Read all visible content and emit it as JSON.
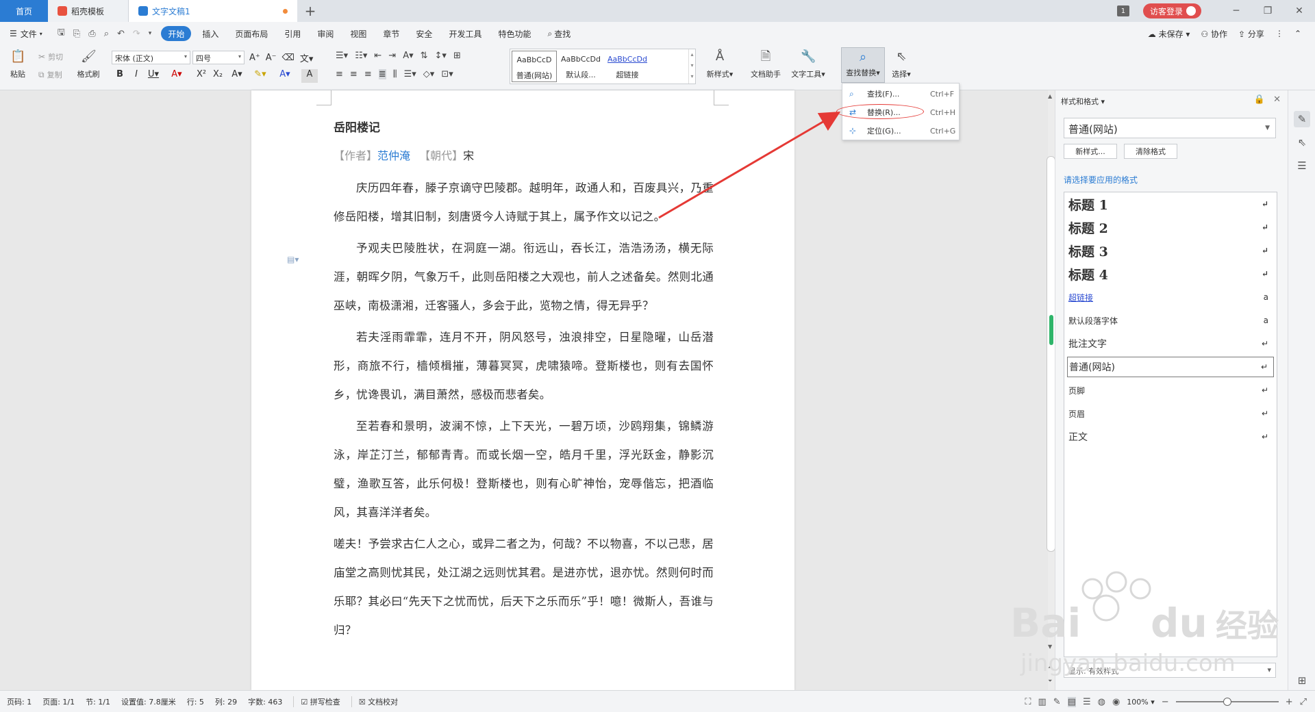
{
  "tabs": {
    "home": "首页",
    "daoke": "稻壳模板",
    "doc": "文字文稿1",
    "new_tab": "+",
    "badge": "1",
    "login": "访客登录"
  },
  "menu": {
    "file": "文件",
    "items": [
      "开始",
      "插入",
      "页面布局",
      "引用",
      "审阅",
      "视图",
      "章节",
      "安全",
      "开发工具",
      "特色功能"
    ],
    "search": "查找",
    "unsaved": "未保存",
    "collab": "协作",
    "share": "分享"
  },
  "ribbon": {
    "paste": "粘贴",
    "cut": "剪切",
    "copy": "复制",
    "format_painter": "格式刷",
    "font_name": "宋体 (正文)",
    "font_size": "四号",
    "styles": [
      {
        "preview": "AaBbCcD",
        "label": "普通(网站)"
      },
      {
        "preview": "AaBbCcDd",
        "label": "默认段..."
      },
      {
        "preview": "AaBbCcDd",
        "label": "超链接"
      }
    ],
    "new_style": "新样式",
    "doc_helper": "文档助手",
    "text_tools": "文字工具",
    "find_replace": "查找替换",
    "select": "选择"
  },
  "find_menu": {
    "items": [
      {
        "label": "查找(F)...",
        "shortcut": "Ctrl+F",
        "icon": "search-icon"
      },
      {
        "label": "替换(R)...",
        "shortcut": "Ctrl+H",
        "icon": "replace-icon"
      },
      {
        "label": "定位(G)...",
        "shortcut": "Ctrl+G",
        "icon": "goto-icon"
      }
    ]
  },
  "document": {
    "title": "岳阳楼记",
    "meta_author_label": "【作者】",
    "meta_author": "范仲淹",
    "meta_dynasty_label": "【朝代】",
    "meta_dynasty": "宋",
    "paragraphs": [
      "庆历四年春，滕子京谪守巴陵郡。越明年，政通人和，百废具兴，乃重修岳阳楼，增其旧制，刻唐贤今人诗赋于其上，属予作文以记之。",
      "予观夫巴陵胜状，在洞庭一湖。衔远山，吞长江，浩浩汤汤，横无际涯，朝晖夕阴，气象万千，此则岳阳楼之大观也，前人之述备矣。然则北通巫峡，南极潇湘，迁客骚人，多会于此，览物之情，得无异乎？",
      "若夫淫雨霏霏，连月不开，阴风怒号，浊浪排空，日星隐曜，山岳潜形，商旅不行，樯倾楫摧，薄暮冥冥，虎啸猿啼。登斯楼也，则有去国怀乡，忧谗畏讥，满目萧然，感极而悲者矣。",
      "至若春和景明，波澜不惊，上下天光，一碧万顷，沙鸥翔集，锦鳞游泳，岸芷汀兰，郁郁青青。而或长烟一空，皓月千里，浮光跃金，静影沉璧，渔歌互答，此乐何极！登斯楼也，则有心旷神怡，宠辱偕忘，把酒临风，其喜洋洋者矣。",
      "嗟夫！予尝求古仁人之心，或异二者之为，何哉？不以物喜，不以己悲，居庙堂之高则忧其民，处江湖之远则忧其君。是进亦忧，退亦忧。然则何时而乐耶？其必曰“先天下之忧而忧，后天下之乐而乐”乎！噫！微斯人，吾谁与归？"
    ]
  },
  "styles_panel": {
    "title": "样式和格式",
    "current_style": "普通(网站)",
    "new_style_btn": "新样式...",
    "clear_format_btn": "清除格式",
    "hint": "请选择要应用的格式",
    "items": [
      {
        "name": "标题  1",
        "mark": "↵"
      },
      {
        "name": "标题  2",
        "mark": "↵"
      },
      {
        "name": "标题  3",
        "mark": "↵"
      },
      {
        "name": "标题  4",
        "mark": "↵"
      },
      {
        "name": "超链接",
        "mark": "a"
      },
      {
        "name": "默认段落字体",
        "mark": "a"
      },
      {
        "name": "批注文字",
        "mark": "↵"
      },
      {
        "name": "普通(网站)",
        "mark": "↵"
      },
      {
        "name": "页脚",
        "mark": "↵"
      },
      {
        "name": "页眉",
        "mark": "↵"
      },
      {
        "name": "正文",
        "mark": "↵"
      }
    ],
    "show_label": "显示: 有效样式"
  },
  "status": {
    "page_num": "页码: 1",
    "pages": "页面: 1/1",
    "section": "节: 1/1",
    "setting": "设置值: 7.8厘米",
    "row": "行: 5",
    "col": "列: 29",
    "words": "字数: 463",
    "spell": "拼写检查",
    "proof": "文档校对",
    "zoom": "100%",
    "zoom_level": 0.5
  },
  "colors": {
    "accent": "#2b7cd3",
    "annotation_red": "#e53935",
    "login_red": "#e04e4e",
    "dirty_dot": "#f28c3c"
  }
}
